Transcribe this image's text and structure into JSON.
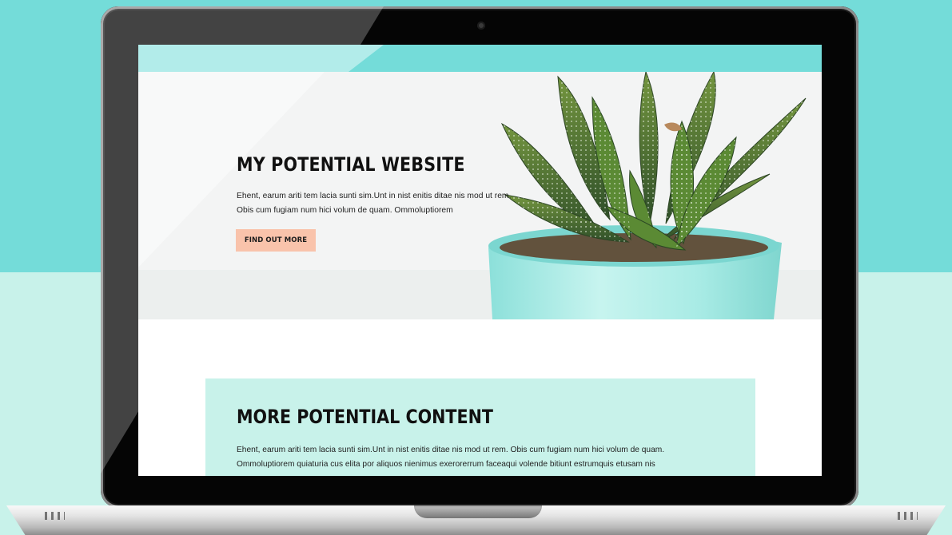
{
  "site": {
    "hero": {
      "title": "MY POTENTIAL WEBSITE",
      "body": "Ehent, earum ariti tem lacia sunti sim.Unt in nist enitis ditae nis mod ut rem. Obis cum fugiam num hici volum de quam. Ommoluptiorem",
      "button_label": "FIND OUT MORE"
    },
    "content": {
      "title": "MORE POTENTIAL CONTENT",
      "body": "Ehent, earum ariti tem lacia sunti sim.Unt in nist enitis ditae nis mod ut rem. Obis cum fugiam num hici volum de quam. Ommoluptiorem quiaturia cus elita por aliquos nienimus exerorerrum faceaqui volende bitiunt estrumquis etusam nis"
    }
  },
  "colors": {
    "background_top": "#74dcd9",
    "background_bottom": "#c8f2ea",
    "header": "#74dcd9",
    "button": "#f9c3ab",
    "content_card": "#c8f2ea",
    "laptop_bezel": "#050505",
    "plant_pot": "#b2ece8"
  },
  "icons": {
    "camera": "camera-icon",
    "plant": "succulent-plant-image"
  }
}
